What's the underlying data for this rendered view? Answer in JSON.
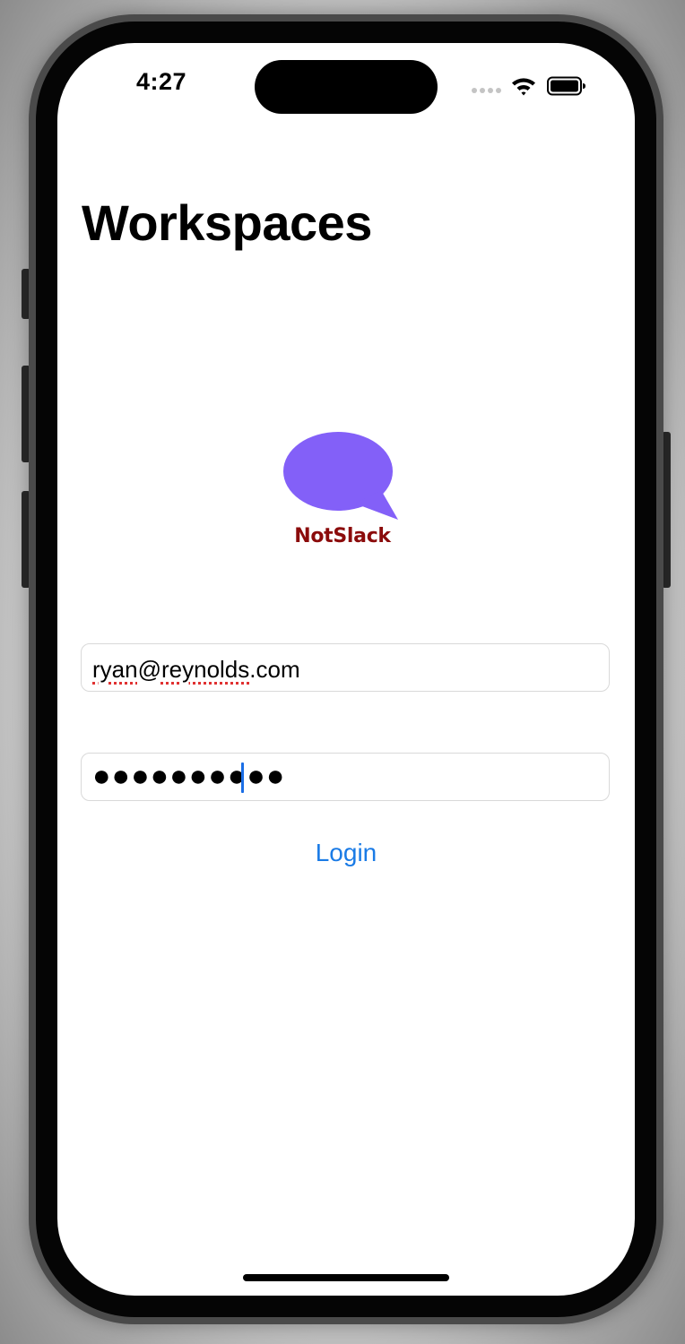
{
  "status_bar": {
    "time": "4:27"
  },
  "header": {
    "title": "Workspaces"
  },
  "branding": {
    "app_name": "NotSlack",
    "logo_icon": "speech-bubble-icon",
    "logo_color": "#8360f8",
    "name_color": "#8b0b0b"
  },
  "login_form": {
    "email": {
      "value_misspelled_1": "ryan",
      "value_mid": "@",
      "value_misspelled_2": "reynolds",
      "value_end": ".com"
    },
    "password": {
      "masked_value": "●●●●●●●●●●"
    },
    "login_label": "Login",
    "accent_color": "#1a7be6"
  }
}
